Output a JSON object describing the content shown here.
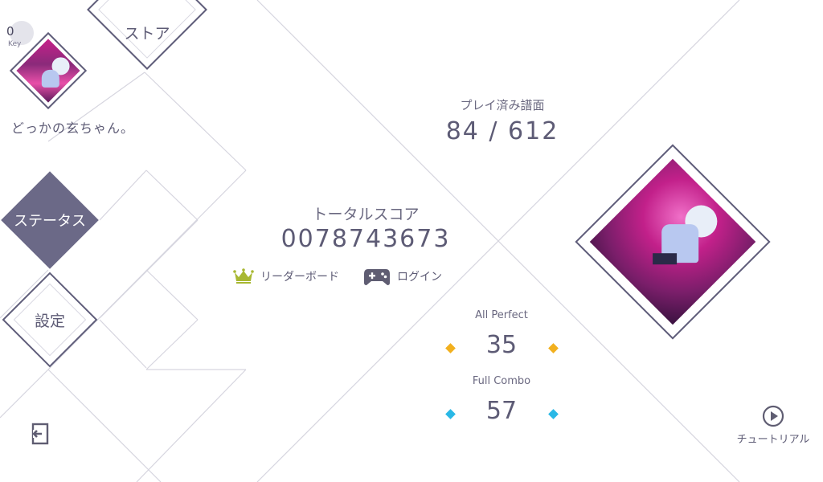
{
  "nav": {
    "store_label": "ストア",
    "status_label": "ステータス",
    "settings_label": "設定"
  },
  "key": {
    "count": "0",
    "label": "Key"
  },
  "user": {
    "name": "どっかの玄ちゃん。"
  },
  "stats": {
    "played_label": "プレイ済み譜面",
    "played_value": "84 / 612",
    "total_score_label": "トータルスコア",
    "total_score_value": "0078743673",
    "all_perfect_label": "All Perfect",
    "all_perfect_value": "35",
    "full_combo_label": "Full Combo",
    "full_combo_value": "57"
  },
  "actions": {
    "leaderboard_label": "リーダーボード",
    "login_label": "ログイン",
    "tutorial_label": "チュートリアル"
  },
  "colors": {
    "accent_dark": "#6b6987",
    "crown": "#a8b832",
    "ap_gem": "#f2b01e",
    "fc_gem": "#2ab8e6"
  },
  "icons": {
    "crown": "crown-icon",
    "gamepad": "gamepad-icon",
    "play": "play-circle-icon",
    "exit": "exit-icon"
  }
}
